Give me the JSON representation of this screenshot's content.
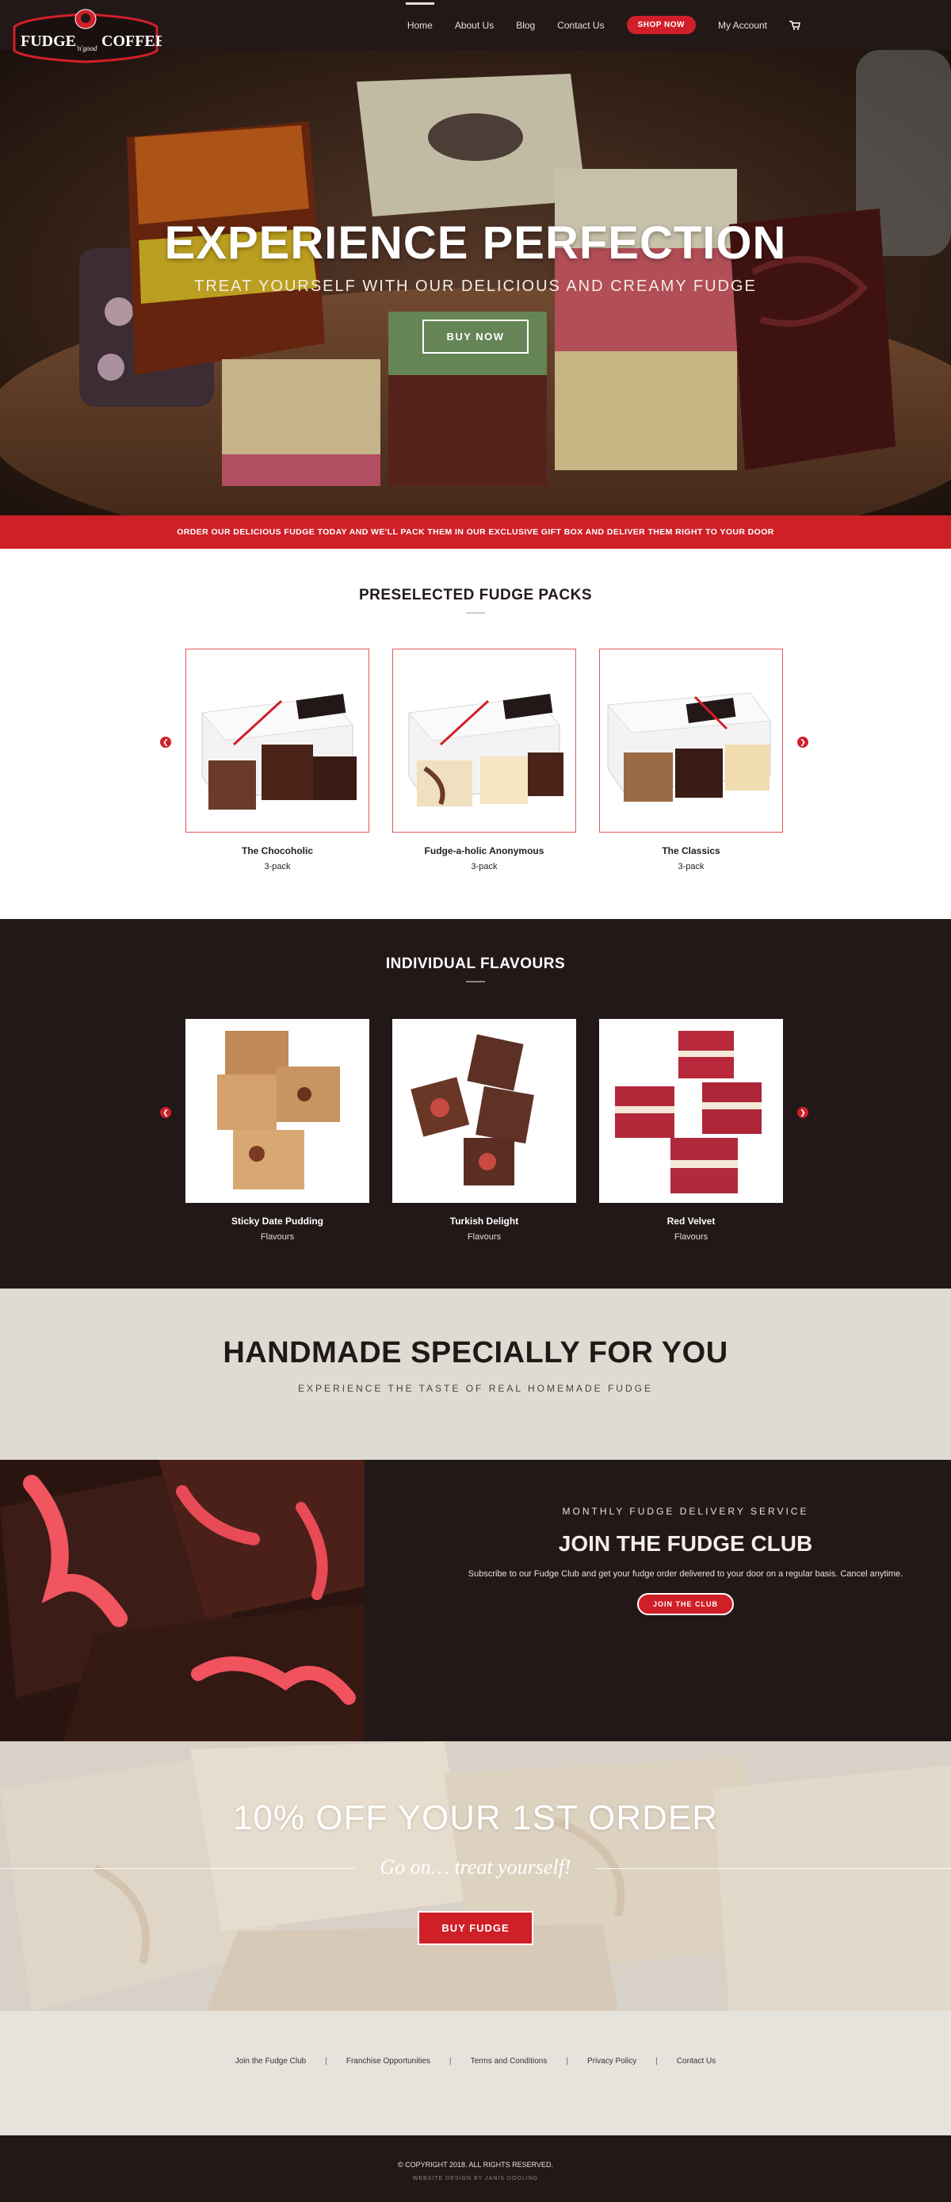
{
  "header": {
    "logo_text_left": "FUDGE",
    "logo_text_mid": "'n'good",
    "logo_text_right": "COFFEE",
    "nav": [
      "Home",
      "About Us",
      "Blog",
      "Contact Us",
      "SHOP NOW",
      "My Account"
    ],
    "cart_icon": "cart-icon"
  },
  "hero": {
    "title": "EXPERIENCE PERFECTION",
    "subtitle": "TREAT YOURSELF WITH OUR DELICIOUS AND CREAMY FUDGE",
    "button": "BUY NOW"
  },
  "banner": "ORDER OUR DELICIOUS FUDGE TODAY AND WE'LL PACK THEM IN OUR EXCLUSIVE GIFT BOX AND DELIVER THEM RIGHT TO YOUR DOOR",
  "packs": {
    "title": "PRESELECTED FUDGE PACKS",
    "items": [
      {
        "name": "The Chocoholic",
        "sub": "3-pack"
      },
      {
        "name": "Fudge-a-holic Anonymous",
        "sub": "3-pack"
      },
      {
        "name": "The Classics",
        "sub": "3-pack"
      }
    ]
  },
  "flavours": {
    "title": "INDIVIDUAL FLAVOURS",
    "items": [
      {
        "name": "Sticky Date Pudding",
        "sub": "Flavours"
      },
      {
        "name": "Turkish Delight",
        "sub": "Flavours"
      },
      {
        "name": "Red Velvet",
        "sub": "Flavours"
      }
    ]
  },
  "handmade": {
    "title": "HANDMADE SPECIALLY FOR YOU",
    "subtitle": "EXPERIENCE THE TASTE OF REAL HOMEMADE FUDGE"
  },
  "club": {
    "kicker": "MONTHLY FUDGE DELIVERY SERVICE",
    "title": "JOIN THE FUDGE CLUB",
    "text": "Subscribe to our Fudge Club and get your fudge order delivered to your door on a regular basis. Cancel anytime.",
    "button": "JOIN THE CLUB"
  },
  "promo": {
    "title": "10% OFF YOUR 1ST ORDER",
    "tagline": "Go on… treat yourself!",
    "button": "BUY FUDGE"
  },
  "footer": {
    "links": [
      "Join the Fudge Club",
      "Franchise Opportunities",
      "Terms and Conditions",
      "Privacy Policy",
      "Contact Us"
    ],
    "copyright": "© COPYRIGHT 2018. ALL RIGHTS RESERVED.",
    "credit": "WEBSITE DESIGN BY JANIS DOOLING"
  },
  "colors": {
    "dark": "#231818",
    "red": "#cf1f27",
    "cream": "#dedcd2"
  }
}
